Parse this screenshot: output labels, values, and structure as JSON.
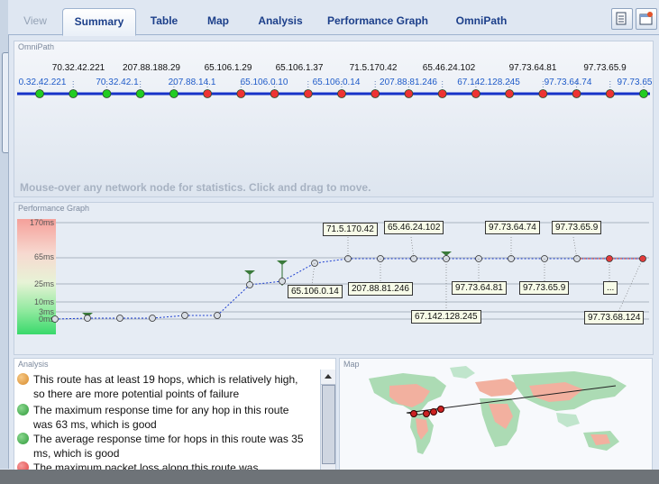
{
  "tabs": [
    {
      "label": "View",
      "state": "muted"
    },
    {
      "label": "Summary",
      "state": "active"
    },
    {
      "label": "Table",
      "state": "normal"
    },
    {
      "label": "Map",
      "state": "normal"
    },
    {
      "label": "Analysis",
      "state": "normal"
    },
    {
      "label": "Performance Graph",
      "state": "normal"
    },
    {
      "label": "OmniPath",
      "state": "normal"
    }
  ],
  "toolbar": {
    "icons": [
      "document-icon",
      "new-window-icon"
    ]
  },
  "omnipath": {
    "title": "OmniPath",
    "top_labels": [
      "70.32.42.221",
      "207.88.188.29",
      "65.106.1.29",
      "65.106.1.37",
      "71.5.170.42",
      "65.46.24.102",
      "97.73.64.81",
      "97.73.65.9"
    ],
    "bottom_labels": [
      "0.32.42.221",
      "70.32.42.1",
      "207.88.14.1",
      "65.106.0.10",
      "65.106.0.14",
      "207.88.81.246",
      "67.142.128.245",
      "97.73.64.74",
      "97.73.65"
    ],
    "node_colors": [
      "#22cc22",
      "#22cc22",
      "#22cc22",
      "#22cc22",
      "#22cc22",
      "#ee3333",
      "#ee3333",
      "#ee3333",
      "#ee3333",
      "#ee3333",
      "#ee3333",
      "#ee3333",
      "#ee3333",
      "#ee3333",
      "#ee3333",
      "#ee3333",
      "#ee3333",
      "#ee3333",
      "#22cc22"
    ],
    "hint": "Mouse-over any network node for statistics. Click and drag to move."
  },
  "performance": {
    "title": "Performance Graph",
    "y_ticks": [
      "170ms",
      "65ms",
      "25ms",
      "10ms",
      "3ms",
      "0ms"
    ],
    "callouts": [
      "71.5.170.42",
      "65.46.24.102",
      "97.73.64.74",
      "97.73.65.9",
      "65.106.0.14",
      "207.88.81.246",
      "97.73.64.81",
      "97.73.65.9",
      "67.142.128.245",
      "...",
      "97.73.68.124"
    ]
  },
  "analysis": {
    "title": "Analysis",
    "items": [
      {
        "text": "This route has at least 19 hops, which is relatively high, so there are more potential points of failure",
        "color": "#d88a2a"
      },
      {
        "text": "The maximum response time for any hop in this route was 63 ms, which is good",
        "color": "#2f9a3a"
      },
      {
        "text": "The average response time for hops in this route was 35 ms, which is good",
        "color": "#2f9a3a"
      },
      {
        "text": "The maximum packet loss along this route was",
        "color": "#e24242"
      }
    ]
  },
  "map": {
    "title": "Map"
  }
}
